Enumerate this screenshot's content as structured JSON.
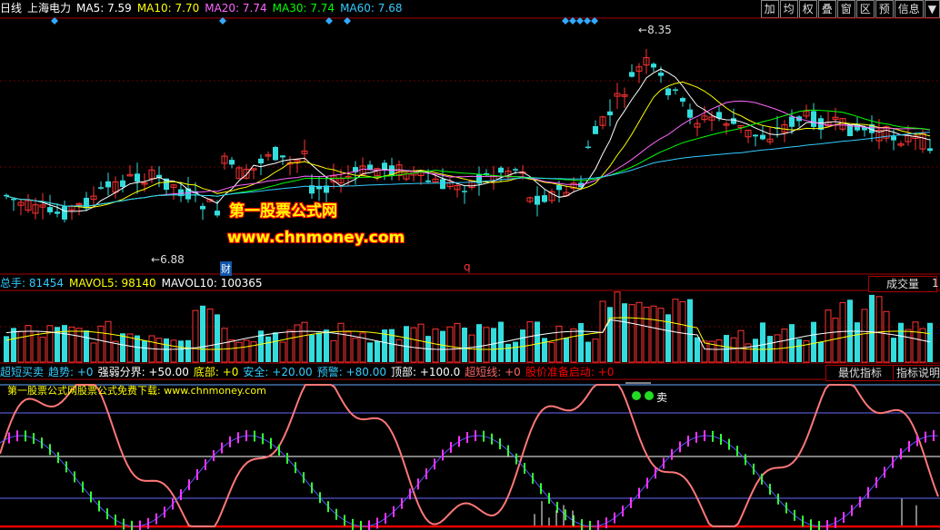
{
  "header": {
    "period": "日线",
    "stock": "上海电力",
    "ma": [
      {
        "label": "MA5: 7.59",
        "color": "#ffffff"
      },
      {
        "label": "MA10: 7.70",
        "color": "#ffff00"
      },
      {
        "label": "MA20: 7.74",
        "color": "#ff66ff"
      },
      {
        "label": "MA30: 7.74",
        "color": "#00ff00"
      },
      {
        "label": "MA60: 7.68",
        "color": "#33ccff"
      }
    ]
  },
  "toolbar": [
    "加",
    "均",
    "权",
    "叠",
    "窗",
    "区",
    "预",
    "信息",
    "▼"
  ],
  "price_chart": {
    "high_label": "8.35",
    "low_label": "6.88",
    "marker_cai": "财",
    "marker_q": "q",
    "watermark_cn": "第一股票公式网",
    "watermark_url": "www.chnmoney.com"
  },
  "volume": {
    "header": [
      {
        "text": "总手: 81454",
        "color": "#33ccff"
      },
      {
        "text": "MAVOL5: 98140",
        "color": "#ffff00"
      },
      {
        "text": "MAVOL10: 100365",
        "color": "#ffffff"
      }
    ],
    "button": "成交量",
    "edge": "1"
  },
  "indicator": {
    "header": [
      {
        "text": "超短买卖",
        "color": "#33ccff"
      },
      {
        "text": "趋势: +0",
        "color": "#33ccff"
      },
      {
        "text": "强弱分界: +50.00",
        "color": "#ffffff"
      },
      {
        "text": "底部: +0",
        "color": "#ffff00"
      },
      {
        "text": "安全: +20.00",
        "color": "#33ccff"
      },
      {
        "text": "预警: +80.00",
        "color": "#33ccff"
      },
      {
        "text": "顶部: +100.0",
        "color": "#ffffff"
      },
      {
        "text": "超短线: +0",
        "color": "#ff6666"
      },
      {
        "text": "股价准备启动: +0",
        "color": "#ff0000"
      }
    ],
    "btn_best": "最优指标",
    "btn_explain": "指标说明",
    "promo": "第一股票公式网股票公式免费下载: www.chnmoney.com",
    "sell_label": "卖"
  },
  "colors": {
    "up": "#ff3333",
    "down": "#33dddd",
    "frame": "#aa0000"
  }
}
